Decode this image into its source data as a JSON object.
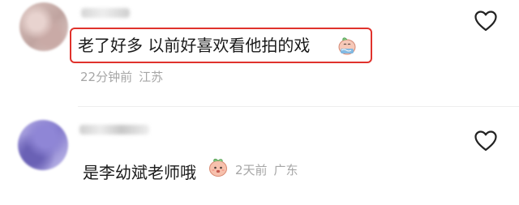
{
  "comments": [
    {
      "text": "老了好多 以前好喜欢看他拍的戏",
      "time": "22分钟前",
      "location": "江苏",
      "emoji": "peach-crying-emoji",
      "highlighted": true
    },
    {
      "text": "是李幼斌老师哦",
      "time": "2天前",
      "location": "广东",
      "emoji": "peach-face-emoji",
      "highlighted": false
    }
  ],
  "colors": {
    "highlight_border": "#e0322c",
    "meta_text": "#a6a6a6",
    "comment_text": "#1a1a1a",
    "heart_stroke": "#222222"
  },
  "icons": {
    "like": "heart-outline-icon"
  }
}
